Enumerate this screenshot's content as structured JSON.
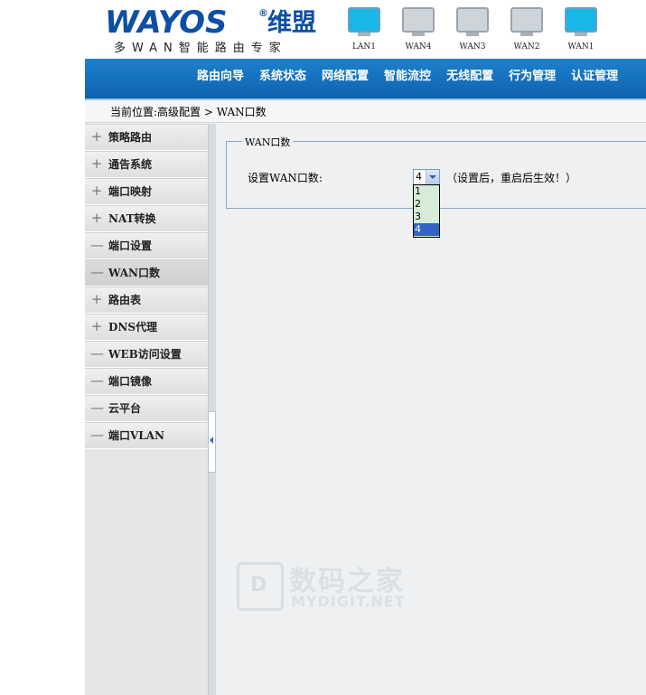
{
  "header": {
    "brand": "WAYOS",
    "registered_mark": "®",
    "brand_cn": "维盟",
    "slogan": "多WAN智能路由专家",
    "ports": [
      {
        "label": "LAN1",
        "active": true
      },
      {
        "label": "WAN4",
        "active": false
      },
      {
        "label": "WAN3",
        "active": false
      },
      {
        "label": "WAN2",
        "active": false
      },
      {
        "label": "WAN1",
        "active": true
      }
    ]
  },
  "nav": {
    "items": [
      "路由向导",
      "系统状态",
      "网络配置",
      "智能流控",
      "无线配置",
      "行为管理",
      "认证管理"
    ]
  },
  "breadcrumb": {
    "text": "当前位置:高级配置 > WAN口数"
  },
  "sidebar": {
    "items": [
      {
        "symbol": "+",
        "label": "策略路由"
      },
      {
        "symbol": "+",
        "label": "通告系统"
      },
      {
        "symbol": "+",
        "label": "端口映射"
      },
      {
        "symbol": "+",
        "label": "NAT转换"
      },
      {
        "symbol": "—",
        "label": "端口设置"
      },
      {
        "symbol": "—",
        "label": "WAN口数"
      },
      {
        "symbol": "+",
        "label": "路由表"
      },
      {
        "symbol": "+",
        "label": "DNS代理"
      },
      {
        "symbol": "—",
        "label": "WEB访问设置"
      },
      {
        "symbol": "—",
        "label": "端口镜像"
      },
      {
        "symbol": "—",
        "label": "云平台"
      },
      {
        "symbol": "—",
        "label": "端口VLAN"
      }
    ],
    "selected": "WAN口数"
  },
  "content": {
    "legend": "WAN口数",
    "wan_label": "设置WAN口数:",
    "select_value": "4",
    "hint": "（设置后，重启后生效！）",
    "options": [
      "1",
      "2",
      "3",
      "4"
    ],
    "selected_option": "4"
  },
  "watermark": {
    "cn": "数码之家",
    "en": "MYDIGIT.NET",
    "logo_letter": "D"
  },
  "colors": {
    "nav_blue": "#0e63ae",
    "brand_blue": "#0d4fa3",
    "port_active": "#19b6e8",
    "option_selected": "#3163c8",
    "dropdown_bg": "#d6ecd8"
  }
}
